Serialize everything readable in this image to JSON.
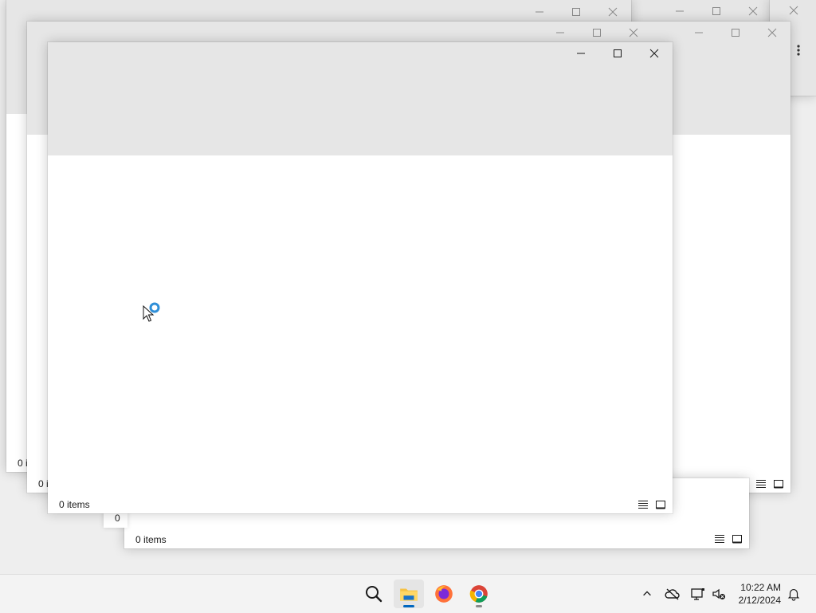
{
  "windows": {
    "status_text": "0 items",
    "status_stub": "0 i"
  },
  "caption_buttons": {
    "minimize": "minimize-icon",
    "maximize": "maximize-icon",
    "close": "close-icon"
  },
  "view_buttons": [
    "details-view-icon",
    "large-icons-view-icon"
  ],
  "taskbar": {
    "apps": [
      {
        "name": "search",
        "icon": "search-icon"
      },
      {
        "name": "file-explorer",
        "icon": "folder-icon",
        "active": true
      },
      {
        "name": "firefox",
        "icon": "firefox-icon"
      },
      {
        "name": "chrome",
        "icon": "chrome-icon"
      }
    ],
    "tray": [
      "chevron-up-icon",
      "onedrive-offline-icon",
      "network-icon",
      "volume-muted-icon",
      "notification-bell-icon"
    ],
    "time": "10:22 AM",
    "date": "2/12/2024"
  },
  "colors": {
    "accent": "#0067c0",
    "window_header": "#e6e6e6",
    "taskbar": "#f3f3f3"
  }
}
